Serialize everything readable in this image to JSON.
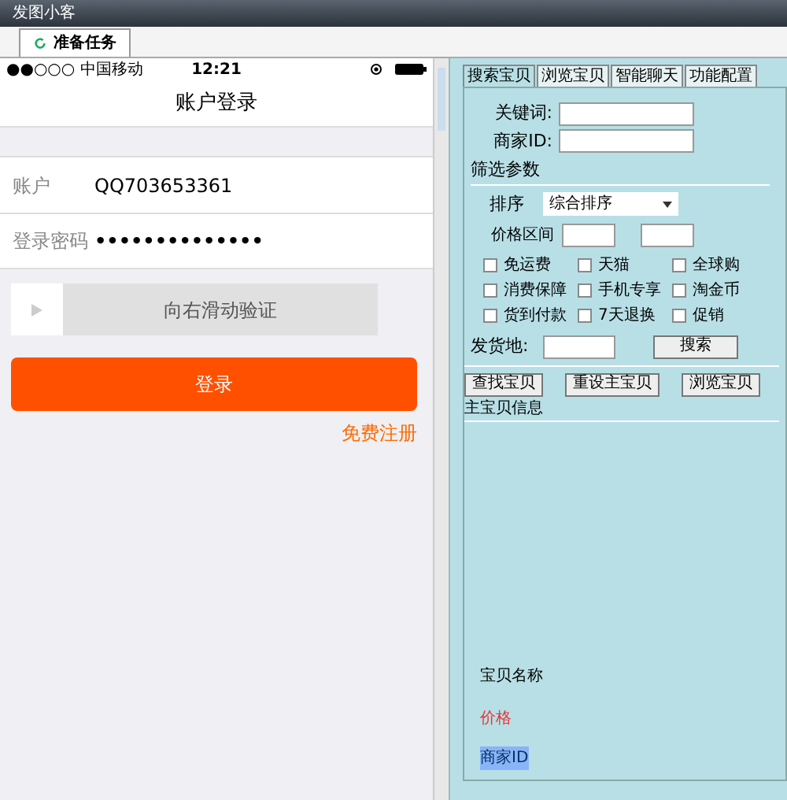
{
  "window": {
    "title": "发图小客"
  },
  "tabs": [
    {
      "label": "准备任务",
      "selected": true
    }
  ],
  "phone": {
    "status_bar": {
      "carrier": "●●○○○ 中国移动",
      "time": "12:21"
    },
    "title": "账户登录",
    "fields": [
      {
        "label": "账户",
        "value": "QQ703653361"
      },
      {
        "label": "登录密码",
        "value": "••••••••••••••"
      }
    ],
    "slider_text": "向右滑动验证",
    "login_button": "登录",
    "register_link": "免费注册"
  },
  "right_tabs": [
    {
      "label": "搜索宝贝",
      "selected": true
    },
    {
      "label": "浏览宝贝",
      "selected": false
    },
    {
      "label": "智能聊天",
      "selected": false
    },
    {
      "label": "功能配置",
      "selected": false
    }
  ],
  "search": {
    "keyword_label": "关键词:",
    "seller_label": "商家ID:",
    "filter_title": "筛选参数",
    "sort_label": "排序",
    "sort_value": "综合排序",
    "price_label": "价格区间",
    "checkboxes": [
      {
        "label": "免运费",
        "checked": false
      },
      {
        "label": "天猫",
        "checked": false
      },
      {
        "label": "全球购",
        "checked": false
      },
      {
        "label": "消费保障",
        "checked": false
      },
      {
        "label": "手机专享",
        "checked": false
      },
      {
        "label": "淘金币",
        "checked": false
      },
      {
        "label": "货到付款",
        "checked": false
      },
      {
        "label": "7天退换",
        "checked": false
      },
      {
        "label": "促销",
        "checked": false
      }
    ],
    "location_label": "发货地:",
    "search_button": "搜索"
  },
  "actions": [
    "查找宝贝",
    "重设主宝贝",
    "浏览宝贝"
  ],
  "main_item": {
    "title": "主宝贝信息",
    "name_label": "宝贝名称",
    "price_label": "价格",
    "seller_label": "商家ID"
  }
}
